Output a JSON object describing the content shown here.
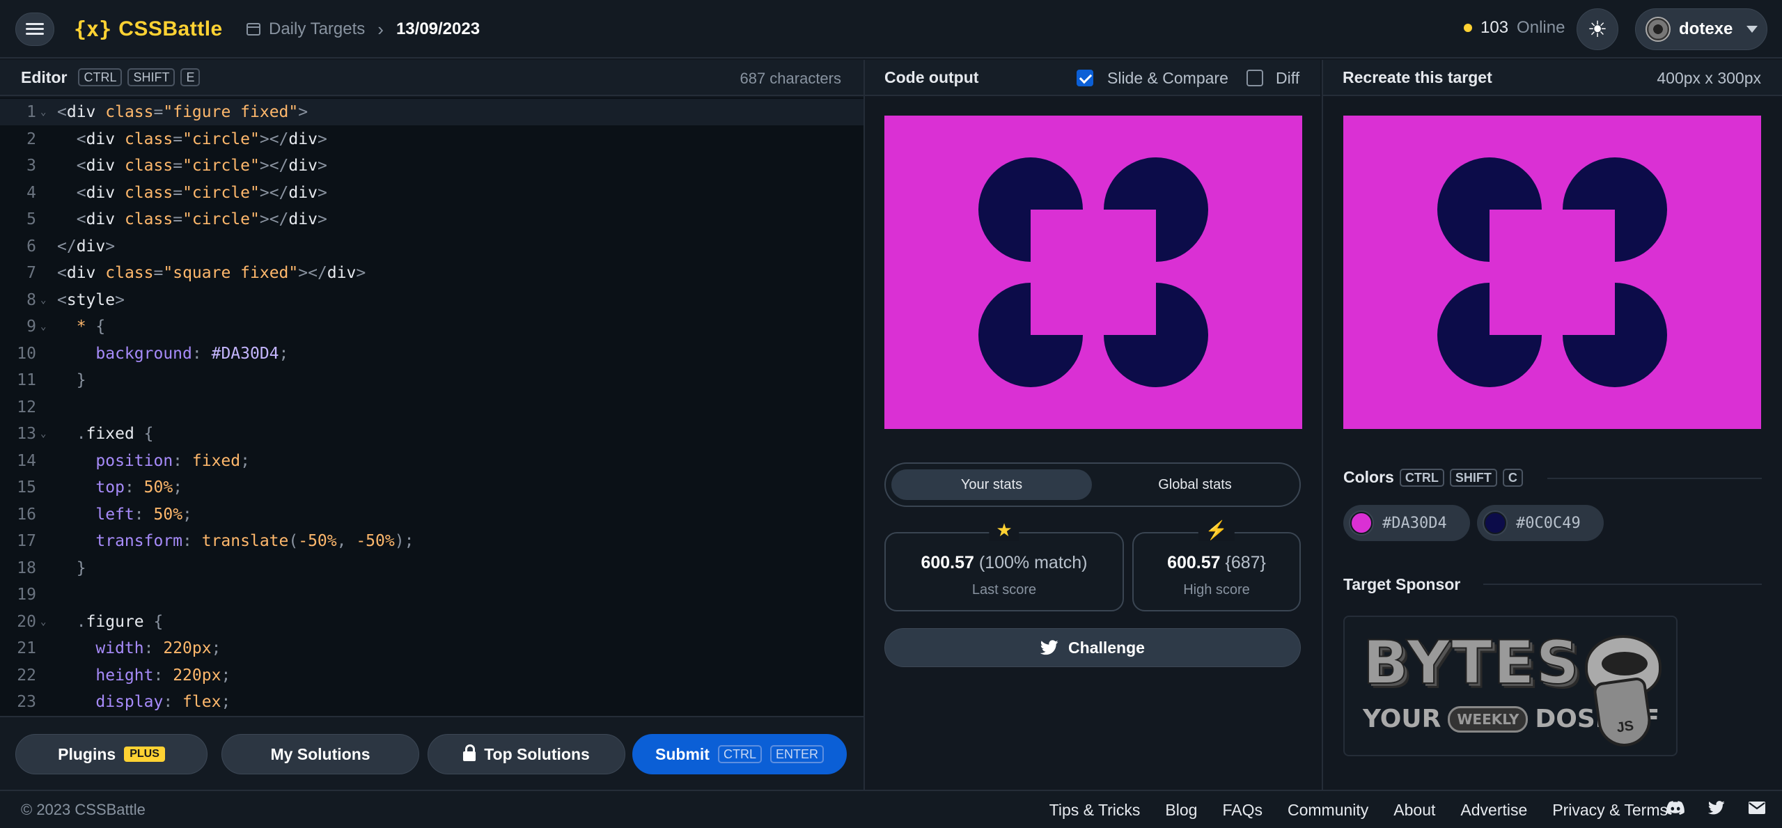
{
  "header": {
    "logo_mark": "{x}",
    "logo_text": "CSSBattle",
    "breadcrumb_section": "Daily Targets",
    "breadcrumb_date": "13/09/2023",
    "online_count": "103",
    "online_label": "Online",
    "username": "dotexe"
  },
  "editor": {
    "title": "Editor",
    "shortcut": [
      "CTRL",
      "SHIFT",
      "E"
    ],
    "char_count": "687 characters",
    "lines": [
      {
        "n": "1",
        "fold": true,
        "active": true,
        "html": "<span class='t-tag'>&lt;</span><span class='t-el'>div</span> <span class='t-attr'>class</span><span class='t-punct'>=</span><span class='t-str'>\"figure fixed\"</span><span class='t-tag'>&gt;</span>"
      },
      {
        "n": "2",
        "html": "  <span class='t-tag'>&lt;</span><span class='t-el'>div</span> <span class='t-attr'>class</span><span class='t-punct'>=</span><span class='t-str'>\"circle\"</span><span class='t-tag'>&gt;&lt;/</span><span class='t-el'>div</span><span class='t-tag'>&gt;</span>"
      },
      {
        "n": "3",
        "html": "  <span class='t-tag'>&lt;</span><span class='t-el'>div</span> <span class='t-attr'>class</span><span class='t-punct'>=</span><span class='t-str'>\"circle\"</span><span class='t-tag'>&gt;&lt;/</span><span class='t-el'>div</span><span class='t-tag'>&gt;</span>"
      },
      {
        "n": "4",
        "html": "  <span class='t-tag'>&lt;</span><span class='t-el'>div</span> <span class='t-attr'>class</span><span class='t-punct'>=</span><span class='t-str'>\"circle\"</span><span class='t-tag'>&gt;&lt;/</span><span class='t-el'>div</span><span class='t-tag'>&gt;</span>"
      },
      {
        "n": "5",
        "html": "  <span class='t-tag'>&lt;</span><span class='t-el'>div</span> <span class='t-attr'>class</span><span class='t-punct'>=</span><span class='t-str'>\"circle\"</span><span class='t-tag'>&gt;&lt;/</span><span class='t-el'>div</span><span class='t-tag'>&gt;</span>"
      },
      {
        "n": "6",
        "html": "<span class='t-tag'>&lt;/</span><span class='t-el'>div</span><span class='t-tag'>&gt;</span>"
      },
      {
        "n": "7",
        "html": "<span class='t-tag'>&lt;</span><span class='t-el'>div</span> <span class='t-attr'>class</span><span class='t-punct'>=</span><span class='t-str'>\"square fixed\"</span><span class='t-tag'>&gt;&lt;/</span><span class='t-el'>div</span><span class='t-tag'>&gt;</span>"
      },
      {
        "n": "8",
        "fold": true,
        "html": "<span class='t-tag'>&lt;</span><span class='t-el'>style</span><span class='t-tag'>&gt;</span>"
      },
      {
        "n": "9",
        "fold": true,
        "html": "  <span class='t-star'>*</span> <span class='t-punct'>{</span>"
      },
      {
        "n": "10",
        "html": "    <span class='t-prop'>background</span><span class='t-punct'>:</span> <span class='t-hex'>#DA30D4</span><span class='t-punct'>;</span>"
      },
      {
        "n": "11",
        "html": "  <span class='t-punct'>}</span>"
      },
      {
        "n": "12",
        "html": ""
      },
      {
        "n": "13",
        "fold": true,
        "html": "  <span class='t-punct'>.</span><span class='t-sel'>fixed</span> <span class='t-punct'>{</span>"
      },
      {
        "n": "14",
        "html": "    <span class='t-prop'>position</span><span class='t-punct'>:</span> <span class='t-val'>fixed</span><span class='t-punct'>;</span>"
      },
      {
        "n": "15",
        "html": "    <span class='t-prop'>top</span><span class='t-punct'>:</span> <span class='t-val'>50%</span><span class='t-punct'>;</span>"
      },
      {
        "n": "16",
        "html": "    <span class='t-prop'>left</span><span class='t-punct'>:</span> <span class='t-val'>50%</span><span class='t-punct'>;</span>"
      },
      {
        "n": "17",
        "html": "    <span class='t-prop'>transform</span><span class='t-punct'>:</span> <span class='t-val'>translate</span><span class='t-punct'>(</span><span class='t-val'>-50%</span><span class='t-punct'>,</span> <span class='t-val'>-50%</span><span class='t-punct'>);</span>"
      },
      {
        "n": "18",
        "html": "  <span class='t-punct'>}</span>"
      },
      {
        "n": "19",
        "html": ""
      },
      {
        "n": "20",
        "fold": true,
        "html": "  <span class='t-punct'>.</span><span class='t-sel'>figure</span> <span class='t-punct'>{</span>"
      },
      {
        "n": "21",
        "html": "    <span class='t-prop'>width</span><span class='t-punct'>:</span> <span class='t-val'>220px</span><span class='t-punct'>;</span>"
      },
      {
        "n": "22",
        "html": "    <span class='t-prop'>height</span><span class='t-punct'>:</span> <span class='t-val'>220px</span><span class='t-punct'>;</span>"
      },
      {
        "n": "23",
        "html": "    <span class='t-prop'>display</span><span class='t-punct'>:</span> <span class='t-val'>flex</span><span class='t-punct'>;</span>"
      }
    ]
  },
  "buttons": {
    "plugins": "Plugins",
    "plugins_badge": "PLUS",
    "my_solutions": "My Solutions",
    "top_solutions": "Top Solutions",
    "submit": "Submit",
    "submit_keys": [
      "CTRL",
      "ENTER"
    ]
  },
  "output": {
    "title": "Code output",
    "slide_compare_label": "Slide & Compare",
    "slide_compare_checked": true,
    "diff_label": "Diff",
    "diff_checked": false
  },
  "stats": {
    "tab_yours": "Your stats",
    "tab_global": "Global stats",
    "last_score": "600.57",
    "last_match": "(100% match)",
    "last_label": "Last score",
    "high_score": "600.57",
    "high_chars": "{687}",
    "high_label": "High score",
    "challenge": "Challenge"
  },
  "target": {
    "title": "Recreate this target",
    "dims": "400px x 300px",
    "colors_title": "Colors",
    "colors_shortcut": [
      "CTRL",
      "SHIFT",
      "C"
    ],
    "colors": [
      {
        "hex": "#DA30D4"
      },
      {
        "hex": "#0C0C49"
      }
    ],
    "sponsor_title": "Target Sponsor",
    "sponsor_logo": "BYTES",
    "sponsor_tag_1": "YOUR",
    "sponsor_tag_weekly": "WEEKLY",
    "sponsor_tag_2": "DOSE OF",
    "sponsor_badge": "JS"
  },
  "footer": {
    "copyright": "© 2023 CSSBattle",
    "links": [
      "Tips & Tricks",
      "Blog",
      "FAQs",
      "Community",
      "About",
      "Advertise",
      "Privacy & Terms"
    ]
  },
  "palette": {
    "bg": "#121820",
    "accent": "#ffd233",
    "primary": "#0b5fd6",
    "target_bg": "#DA30D4",
    "target_fg": "#0C0C49"
  }
}
